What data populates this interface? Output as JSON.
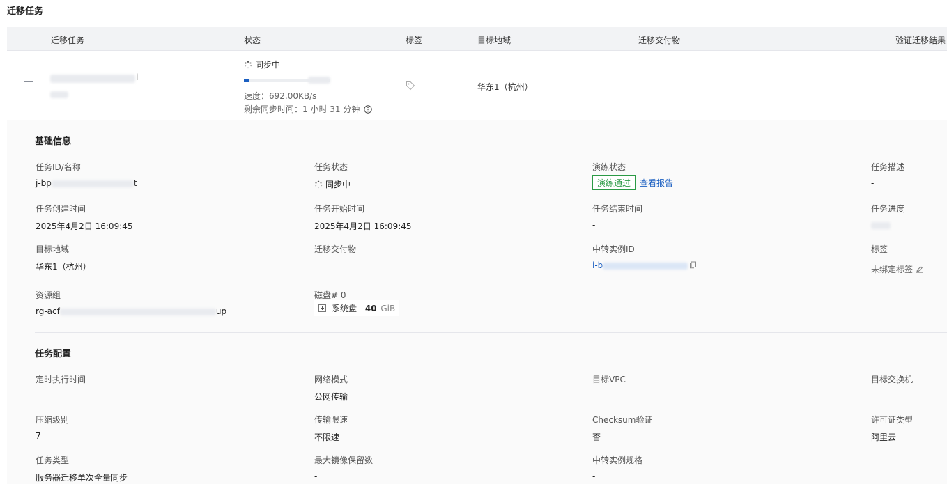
{
  "page": {
    "title": "迁移任务"
  },
  "table": {
    "headers": {
      "task": "迁移任务",
      "status": "状态",
      "tags": "标签",
      "region": "目标地域",
      "deliverable": "迁移交付物",
      "verify": "验证迁移结果"
    },
    "row": {
      "name_suffix": "i",
      "status": "同步中",
      "progress": 0.06,
      "speed": "速度：692.00KB/s",
      "remaining": "剩余同步时间：1 小时 31 分钟",
      "region": "华东1（杭州）"
    }
  },
  "basic": {
    "title": "基础信息",
    "task_id_label": "任务ID/名称",
    "task_id_prefix": "j-bp",
    "task_id_suffix": "t",
    "task_status_label": "任务状态",
    "task_status_value": "同步中",
    "drill_label": "演练状态",
    "drill_badge": "演练通过",
    "drill_link": "查看报告",
    "desc_label": "任务描述",
    "desc_value": "-",
    "created_label": "任务创建时间",
    "created_value": "2025年4月2日 16:09:45",
    "started_label": "任务开始时间",
    "started_value": "2025年4月2日 16:09:45",
    "ended_label": "任务结束时间",
    "ended_value": "-",
    "progress_label": "任务进度",
    "region_label": "目标地域",
    "region_value": "华东1（杭州）",
    "deliverable_label": "迁移交付物",
    "relay_label": "中转实例ID",
    "relay_prefix": "i-b",
    "tags_label": "标签",
    "tags_value": "未绑定标签",
    "rg_label": "资源组",
    "rg_prefix": "rg-acf",
    "rg_suffix": "up",
    "disk_label": "磁盘# 0",
    "disk_name": "系统盘",
    "disk_size": "40",
    "disk_unit": "GiB"
  },
  "config": {
    "title": "任务配置",
    "schedule_label": "定时执行时间",
    "schedule_value": "-",
    "network_label": "网络模式",
    "network_value": "公网传输",
    "vpc_label": "目标VPC",
    "vpc_value": "-",
    "vswitch_label": "目标交换机",
    "vswitch_value": "-",
    "compress_label": "压缩级别",
    "compress_value": "7",
    "bandwidth_label": "传输限速",
    "bandwidth_value": "不限速",
    "checksum_label": "Checksum验证",
    "checksum_value": "否",
    "license_label": "许可证类型",
    "license_value": "阿里云",
    "type_label": "任务类型",
    "type_value": "服务器迁移单次全量同步",
    "max_image_label": "最大镜像保留数",
    "max_image_value": "-",
    "relay_spec_label": "中转实例规格",
    "relay_spec_value": "-"
  },
  "icons": {
    "spinner": "spinner-icon",
    "help": "question-circle-icon",
    "tag": "tag-icon",
    "edit": "edit-icon",
    "copy": "copy-icon"
  },
  "colors": {
    "link": "#1b5fc1",
    "success": "#2b9a45",
    "progress": "#1b5fc1"
  }
}
